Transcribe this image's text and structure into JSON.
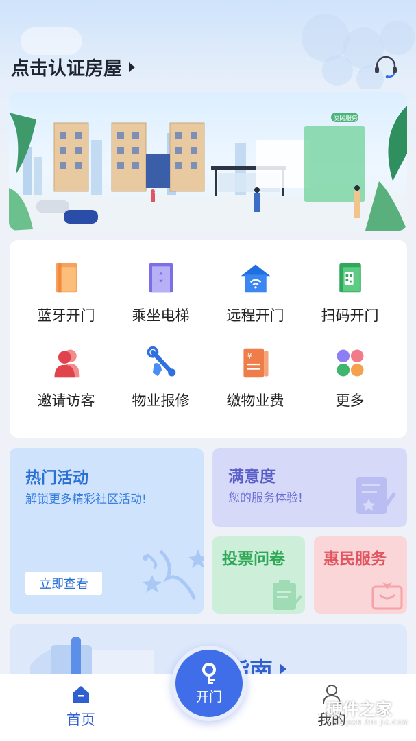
{
  "header": {
    "title": "点击认证房屋",
    "title_arrow_icon": "caret-right-icon",
    "support_icon": "headset-icon"
  },
  "banner": {
    "sign_text": "便民服务",
    "illustration": "community-buildings-illustration"
  },
  "services": [
    {
      "label": "蓝牙开门",
      "icon": "bluetooth-door-icon"
    },
    {
      "label": "乘坐电梯",
      "icon": "elevator-icon"
    },
    {
      "label": "远程开门",
      "icon": "remote-door-icon"
    },
    {
      "label": "扫码开门",
      "icon": "qr-door-icon"
    },
    {
      "label": "邀请访客",
      "icon": "invite-visitor-icon"
    },
    {
      "label": "物业报修",
      "icon": "repair-wrench-icon"
    },
    {
      "label": "缴物业费",
      "icon": "pay-fee-icon"
    },
    {
      "label": "更多",
      "icon": "more-dots-icon"
    }
  ],
  "tiles": {
    "hot": {
      "title": "热门活动",
      "subtitle": "解锁更多精彩社区活动!",
      "button": "立即查看",
      "color": "#2a6fd6"
    },
    "satisfaction": {
      "title": "满意度",
      "subtitle": "您的服务体验!",
      "color": "#5a5fc8"
    },
    "vote": {
      "title": "投票问卷",
      "color": "#2ea856"
    },
    "benefit": {
      "title": "惠民服务",
      "color": "#e0555f"
    }
  },
  "guide": {
    "title": "指南",
    "prefix": "�"
  },
  "tabbar": {
    "home": "首页",
    "open": "开门",
    "mine": "我的"
  },
  "watermark": {
    "main": "硬件之家",
    "sub": "YING JIAN ZHI JIA.COM"
  },
  "colors": {
    "accent": "#3f6ee8",
    "home_tab": "#2f5fd0"
  }
}
